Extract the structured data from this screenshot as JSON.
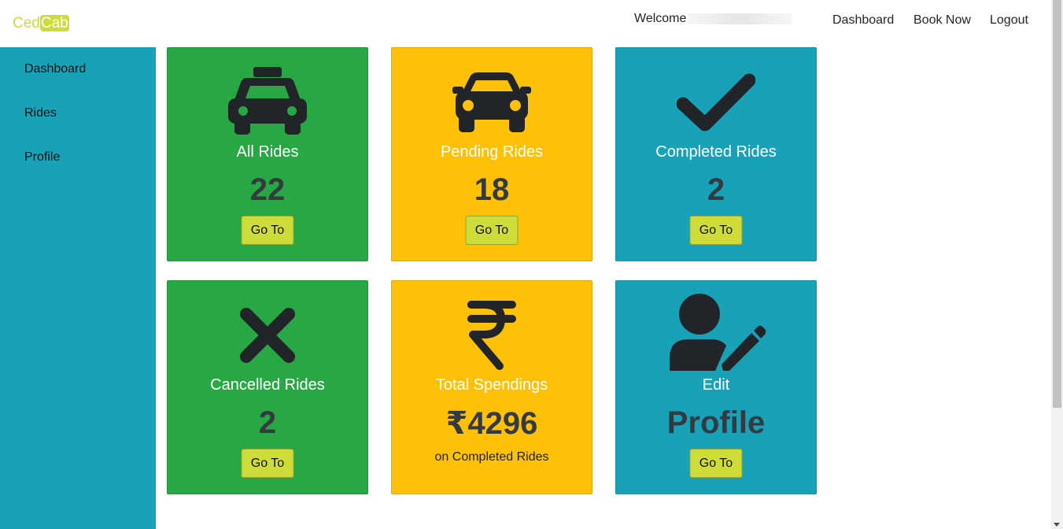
{
  "brand": {
    "part1": "Ced",
    "part2": "Cab"
  },
  "header": {
    "welcome": "Welcome",
    "nav": [
      "Dashboard",
      "Book Now",
      "Logout"
    ]
  },
  "sidebar": {
    "items": [
      "Dashboard",
      "Rides",
      "Profile"
    ]
  },
  "cards": [
    {
      "icon": "taxi-icon",
      "title": "All Rides",
      "value": "22",
      "button": "Go To",
      "color": "#28a745"
    },
    {
      "icon": "car-icon",
      "title": "Pending Rides",
      "value": "18",
      "button": "Go To",
      "color": "#ffc107"
    },
    {
      "icon": "check-icon",
      "title": "Completed Rides",
      "value": "2",
      "button": "Go To",
      "color": "#17a2b8"
    },
    {
      "icon": "times-icon",
      "title": "Cancelled Rides",
      "value": "2",
      "button": "Go To",
      "color": "#28a745"
    },
    {
      "icon": "rupee-icon",
      "title": "Total Spendings",
      "value": "₹4296",
      "subtitle": "on Completed Rides",
      "color": "#ffc107"
    },
    {
      "icon": "user-edit-icon",
      "title": "Edit",
      "value": "Profile",
      "button": "Go To",
      "color": "#17a2b8"
    }
  ],
  "colors": {
    "accent": "#cddc39",
    "sidebar": "#17a2b8",
    "icon": "#212529"
  }
}
